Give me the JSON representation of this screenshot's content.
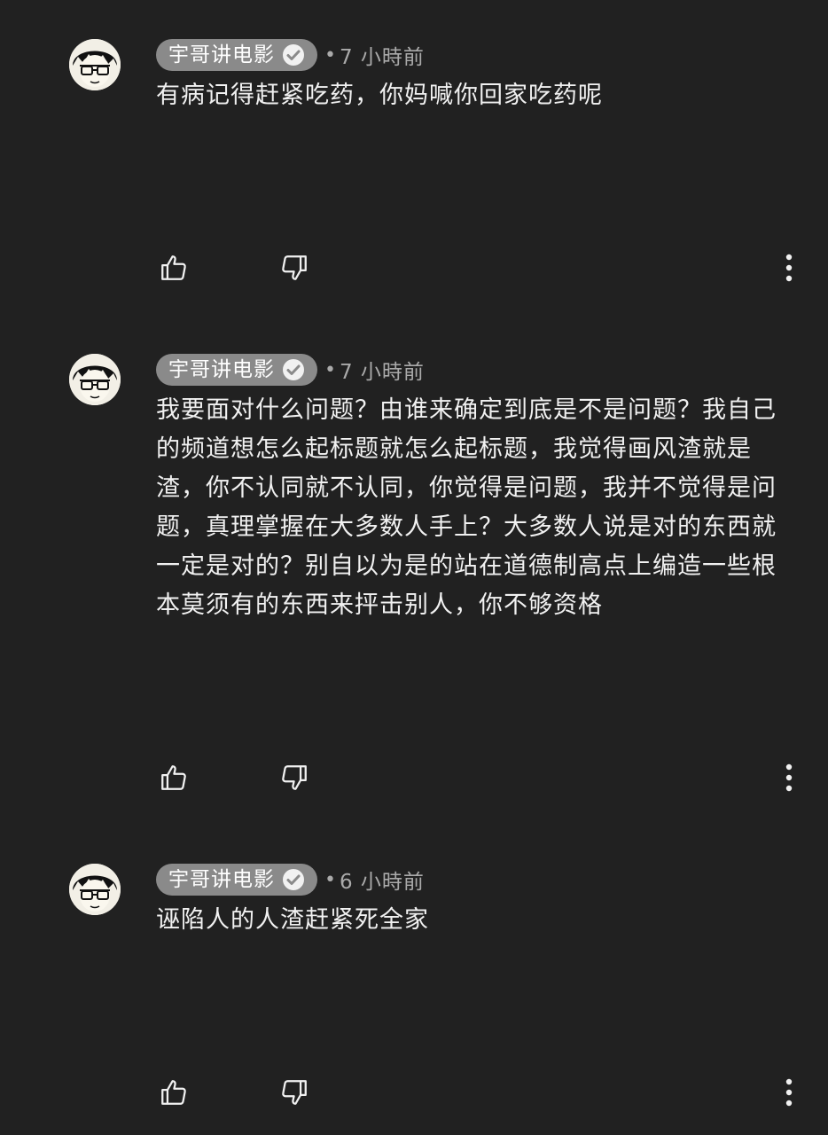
{
  "comments": [
    {
      "author": "宇哥讲电影",
      "separator": "•",
      "time": "7 小時前",
      "text": "有病记得赶紧吃药，你妈喊你回家吃药呢"
    },
    {
      "author": "宇哥讲电影",
      "separator": "•",
      "time": "7 小時前",
      "text": "我要面对什么问题？由谁来确定到底是不是问题？我自己的频道想怎么起标题就怎么起标题，我觉得画风渣就是渣，你不认同就不认同，你觉得是问题，我并不觉得是问题，真理掌握在大多数人手上？大多数人说是对的东西就一定是对的？别自以为是的站在道德制高点上编造一些根本莫须有的东西来抨击别人，你不够资格"
    },
    {
      "author": "宇哥讲电影",
      "separator": "•",
      "time": "6 小時前",
      "text": "诬陷人的人渣赶紧死全家"
    }
  ],
  "icons": {
    "like": "thumbs-up-icon",
    "dislike": "thumbs-down-icon",
    "more": "more-vert-icon",
    "verified": "verified-check-icon"
  },
  "colors": {
    "background": "#212121",
    "author_chip": "#8a8a8a",
    "text": "#f1f1f1",
    "meta": "#aaaaaa"
  }
}
